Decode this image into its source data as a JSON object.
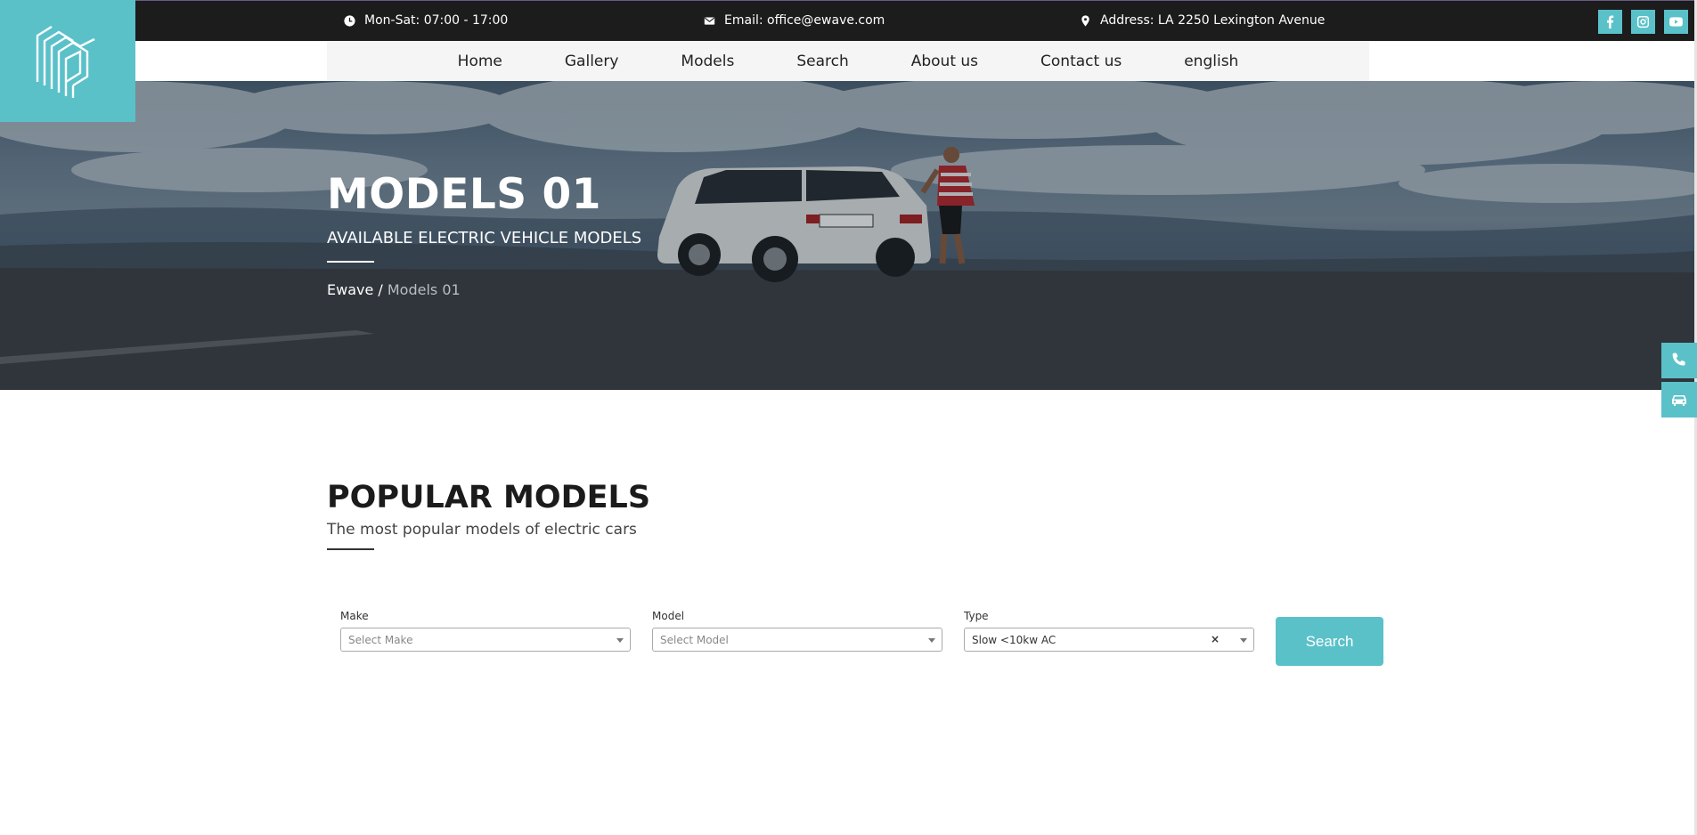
{
  "topbar": {
    "hours": "Mon-Sat: 07:00 - 17:00",
    "email": "Email: office@ewave.com",
    "address": "Address: LA 2250 Lexington Avenue",
    "social": [
      "facebook-icon",
      "instagram-icon",
      "youtube-icon"
    ]
  },
  "nav": {
    "items": [
      "Home",
      "Gallery",
      "Models",
      "Search",
      "About us",
      "Contact us",
      "english"
    ]
  },
  "hero": {
    "title": "MODELS 01",
    "subtitle": "AVAILABLE ELECTRIC VEHICLE MODELS",
    "breadcrumb_home": "Ewave",
    "breadcrumb_sep": " / ",
    "breadcrumb_current": "Models 01"
  },
  "popular": {
    "title": "POPULAR MODELS",
    "subtitle": "The most popular models of electric cars"
  },
  "filters": {
    "make_label": "Make",
    "make_placeholder": "Select Make",
    "model_label": "Model",
    "model_placeholder": "Select Model",
    "type_label": "Type",
    "type_value": "Slow <10kw AC",
    "clear_symbol": "×",
    "search_label": "Search"
  },
  "colors": {
    "accent": "#5ac1c9",
    "topbar": "#1c1c1c",
    "nav_bg": "#f5f5f5"
  }
}
